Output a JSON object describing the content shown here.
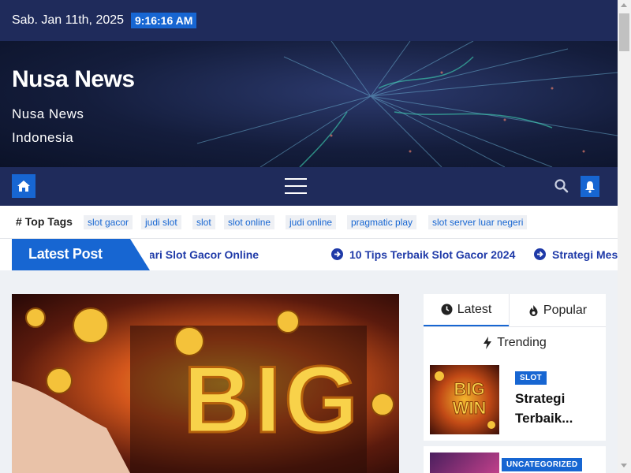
{
  "header": {
    "date": "Sab. Jan 11th, 2025",
    "time": "9:16:16 AM"
  },
  "site": {
    "title": "Nusa News",
    "description": "Nusa News Indonesia"
  },
  "nav": {
    "home_icon": "home-icon",
    "menu_icon": "hamburger-icon",
    "search_icon": "search-icon",
    "bell_icon": "bell-icon"
  },
  "tags": {
    "title": "Top Tags",
    "items": [
      "slot gacor",
      "judi slot",
      "slot",
      "slot online",
      "judi online",
      "pragmatic play",
      "slot server luar negeri"
    ]
  },
  "ticker": {
    "label": "Latest Post",
    "items": [
      "Mencari Slot Gacor Online",
      "10 Tips Terbaik Slot Gacor 2024",
      "Strategi Mesin"
    ]
  },
  "main_post": {
    "image_text": "BIG"
  },
  "sidebar": {
    "tabs": [
      {
        "label": "Latest",
        "icon": "clock-icon"
      },
      {
        "label": "Popular",
        "icon": "fire-icon"
      },
      {
        "label": "Trending",
        "icon": "bolt-icon"
      }
    ],
    "posts": [
      {
        "category": "SLOT",
        "title_line1": "Strategi",
        "title_line2": "Terbaik...",
        "thumb_text_1": "BIG",
        "thumb_text_2": "WIN"
      },
      {
        "category": "UNCATEGORIZED"
      }
    ]
  },
  "colors": {
    "navy": "#1f2b5b",
    "accent": "#1766d2"
  }
}
